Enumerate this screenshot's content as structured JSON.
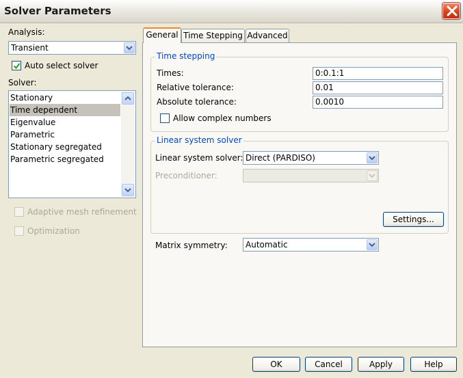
{
  "window": {
    "title": "Solver Parameters"
  },
  "left": {
    "analysis_label": "Analysis:",
    "analysis_value": "Transient",
    "auto_select_label": "Auto select solver",
    "auto_select_checked": true,
    "solver_label": "Solver:",
    "solver_items": [
      "Stationary",
      "Time dependent",
      "Eigenvalue",
      "Parametric",
      "Stationary segregated",
      "Parametric segregated"
    ],
    "selected_solver": "Time dependent",
    "adaptive_label": "Adaptive mesh refinement",
    "optimization_label": "Optimization"
  },
  "tabs": [
    {
      "label": "General",
      "active": true
    },
    {
      "label": "Time Stepping",
      "active": false
    },
    {
      "label": "Advanced",
      "active": false
    }
  ],
  "time_stepping": {
    "title": "Time stepping",
    "times_label": "Times:",
    "times_value": "0:0.1:1",
    "reltol_label": "Relative tolerance:",
    "reltol_value": "0.01",
    "abstol_label": "Absolute tolerance:",
    "abstol_value": "0.0010",
    "complex_label": "Allow complex numbers"
  },
  "linear_solver": {
    "title": "Linear system solver",
    "solver_label": "Linear system solver:",
    "solver_value": "Direct (PARDISO)",
    "preconditioner_label": "Preconditioner:",
    "settings_button": "Settings..."
  },
  "matrix": {
    "label": "Matrix symmetry:",
    "value": "Automatic"
  },
  "footer": {
    "ok": "OK",
    "cancel": "Cancel",
    "apply": "Apply",
    "help": "Help"
  },
  "colors": {
    "group_title": "#0046d5",
    "tab_accent": "#e68b2c",
    "close_button": "#d9421c"
  }
}
